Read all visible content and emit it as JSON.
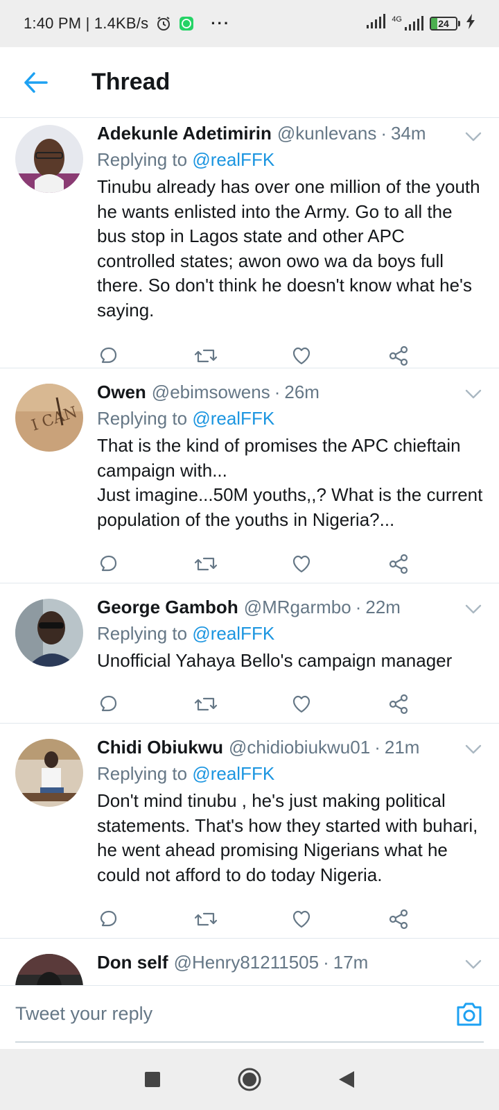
{
  "status_bar": {
    "time": "1:40 PM | 1.4KB/s",
    "more": "···",
    "network": "4G",
    "battery_level": "24",
    "battery_fill_percent": 24
  },
  "header": {
    "title": "Thread"
  },
  "tweets": [
    {
      "name": "Adekunle Adetimirin",
      "handle": "@kunlevans",
      "time": "34m",
      "replying_prefix": "Replying to",
      "replying_to": "@realFFK",
      "text": "Tinubu already has over one million of the youth he wants enlisted into the Army. Go to all the bus stop in Lagos state and other APC controlled states; awon owo wa da boys full there. So don't think he doesn't know what he's saying."
    },
    {
      "name": "Owen",
      "handle": "@ebimsowens",
      "time": "26m",
      "replying_prefix": "Replying to",
      "replying_to": "@realFFK",
      "text": "That is the kind of promises the APC chieftain campaign with...\nJust imagine...50M youths,,? What is the current population of the youths in Nigeria?..."
    },
    {
      "name": "George Gamboh",
      "handle": "@MRgarmbo",
      "time": "22m",
      "replying_prefix": "Replying to",
      "replying_to": "@realFFK",
      "text": "Unofficial Yahaya Bello's campaign manager"
    },
    {
      "name": "Chidi Obiukwu",
      "handle": "@chidiobiukwu01",
      "time": "21m",
      "replying_prefix": "Replying to",
      "replying_to": "@realFFK",
      "text": "Don't mind  tinubu , he's just making political statements. That's how they started with buhari, he went ahead promising Nigerians what he could not afford  to do today Nigeria."
    },
    {
      "name": "Don self",
      "handle": "@Henry81211505",
      "time": "17m",
      "replying_prefix": "",
      "replying_to": "",
      "text": ""
    }
  ],
  "reply_bar": {
    "placeholder": "Tweet your reply"
  },
  "colors": {
    "accent": "#1da1f2",
    "link": "#1b95e0",
    "muted": "#657786",
    "text": "#14171a",
    "divider": "#e1e8ed"
  }
}
